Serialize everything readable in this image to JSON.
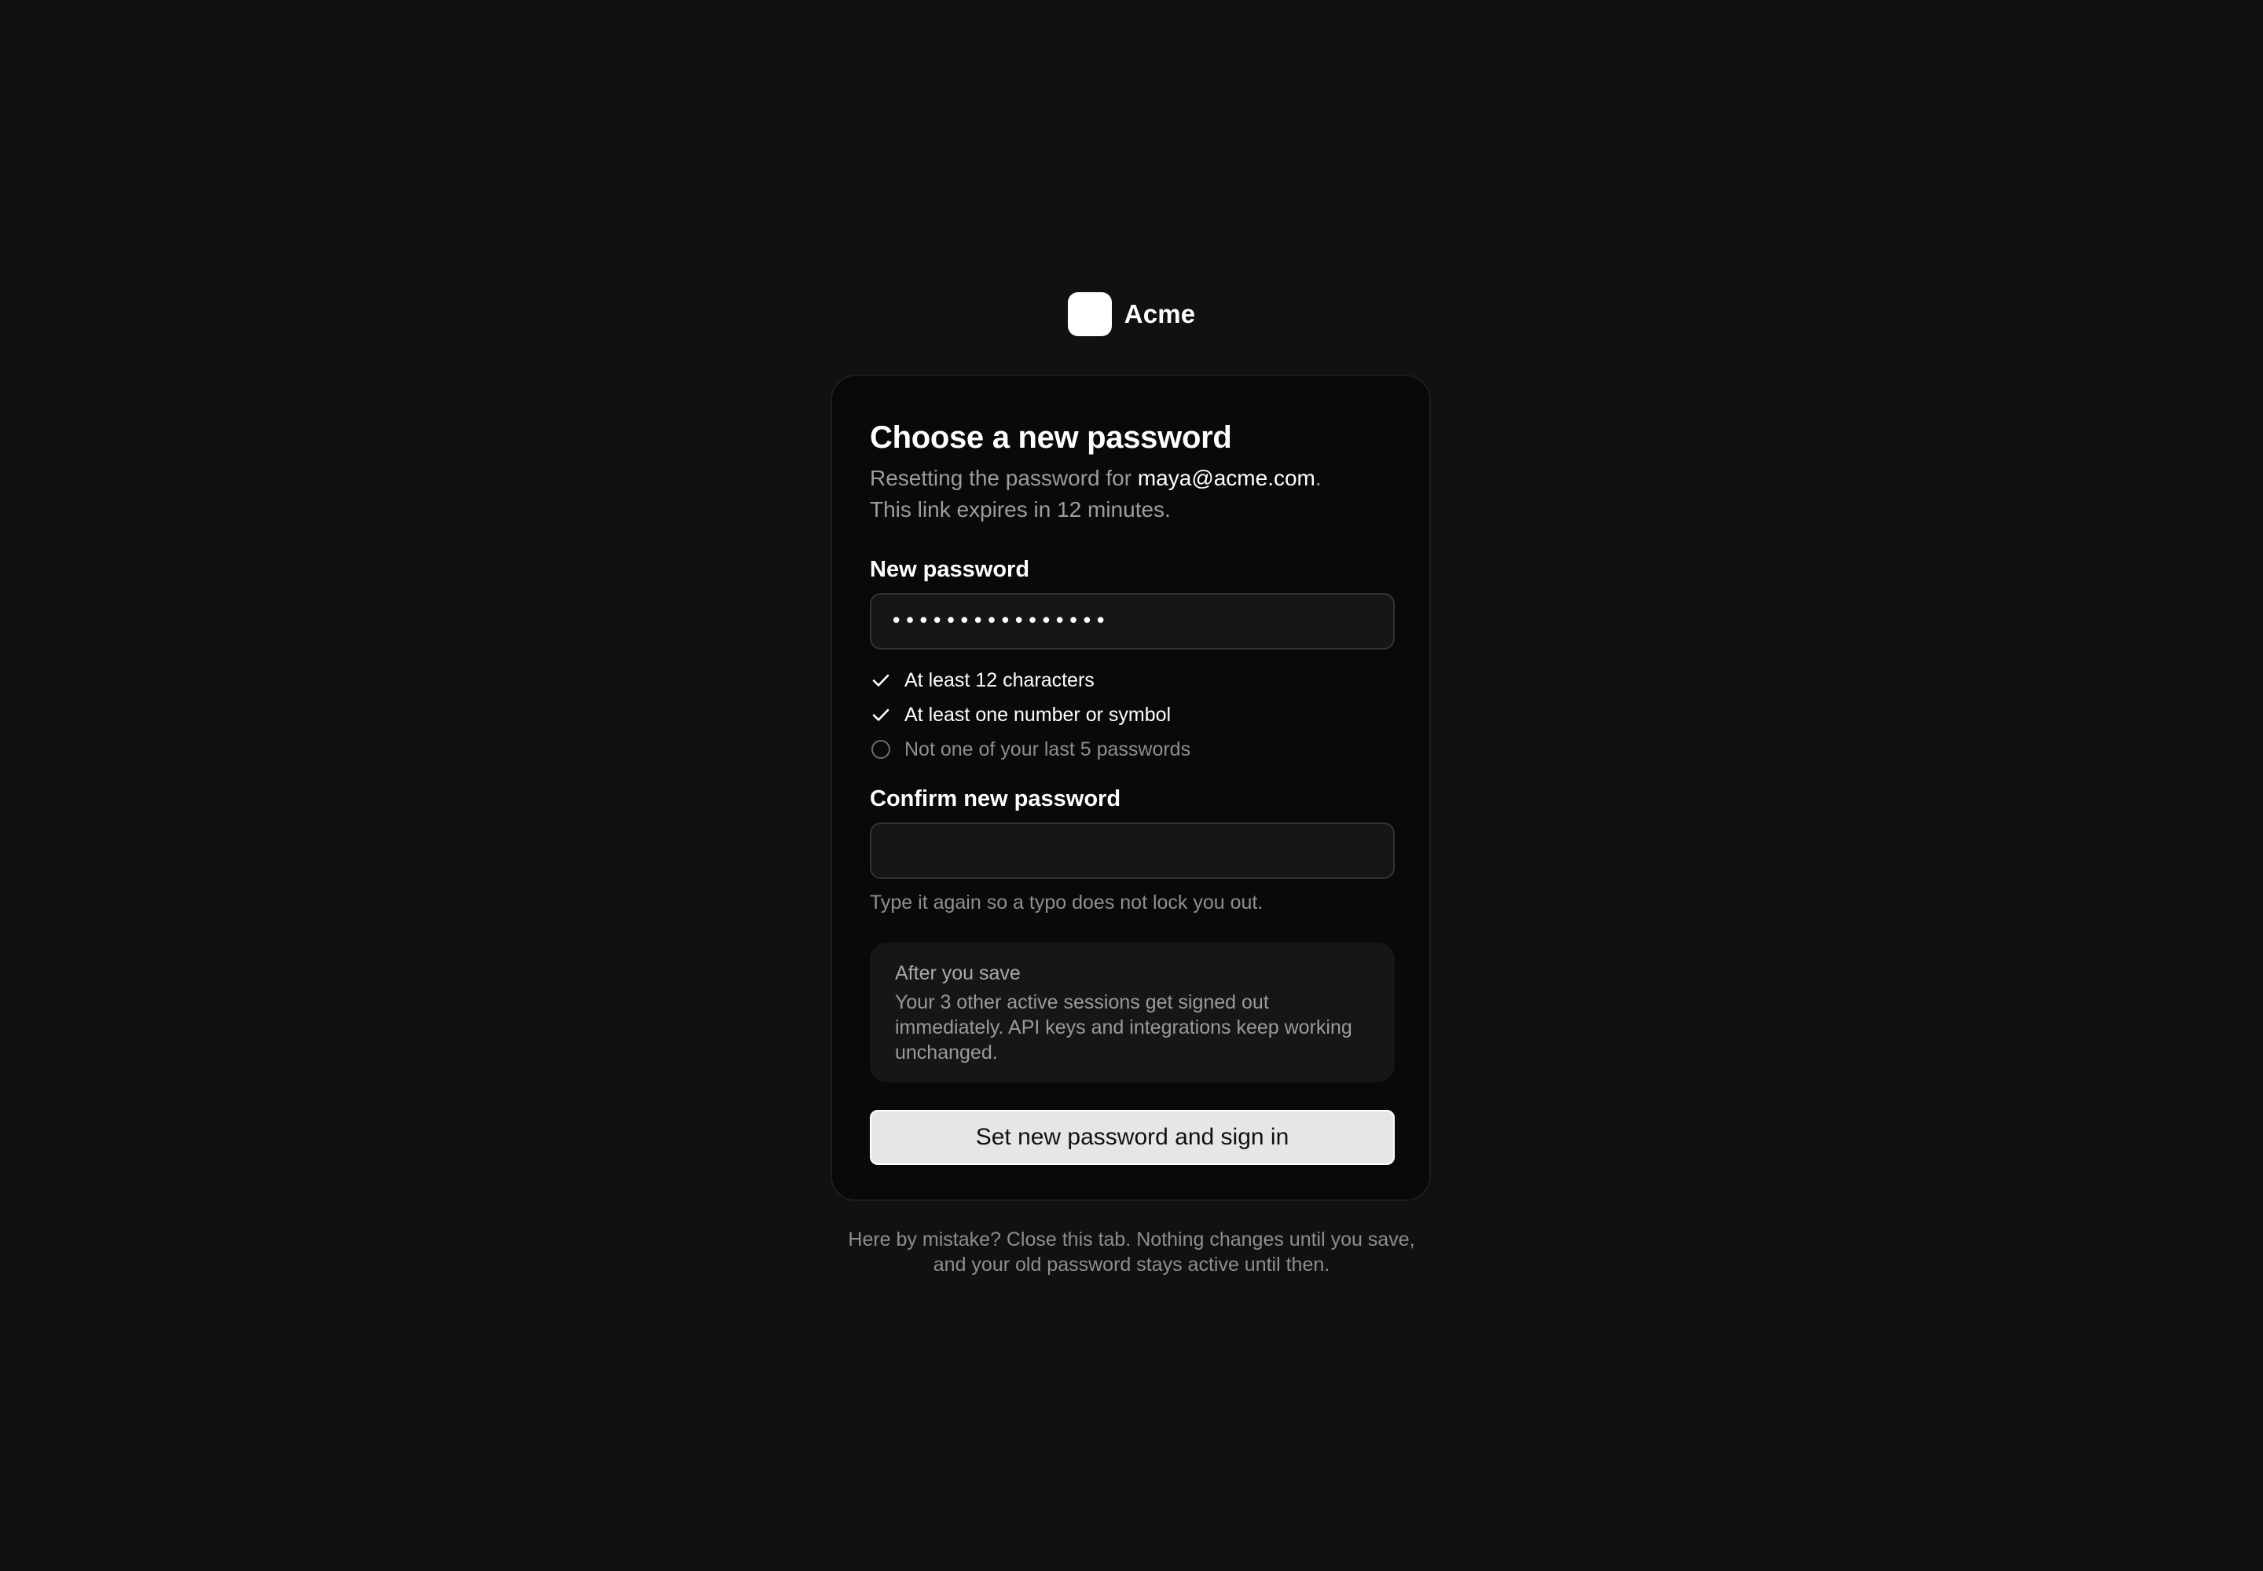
{
  "brand": {
    "name": "Acme"
  },
  "form": {
    "title": "Choose a new password",
    "subtitle_prefix": "Resetting the password for ",
    "email": "maya@acme.com",
    "subtitle_suffix": ".",
    "subtitle_line2": "This link expires in 12 minutes.",
    "new_password": {
      "label": "New password",
      "value": "••••••••••••••••"
    },
    "requirements": [
      {
        "text": "At least 12 characters",
        "met": true,
        "icon": "check-icon"
      },
      {
        "text": "At least one number or symbol",
        "met": true,
        "icon": "check-icon"
      },
      {
        "text": "Not one of your last 5 passwords",
        "met": false,
        "icon": "circle-icon"
      }
    ],
    "confirm_password": {
      "label": "Confirm new password",
      "value": "",
      "hint": "Type it again so a typo does not lock you out."
    },
    "note": {
      "title": "After you save",
      "body": "Your 3 other active sessions get signed out immediately. API keys and integrations keep working unchanged."
    },
    "submit_label": "Set new password and sign in"
  },
  "footer": {
    "line1": "Here by mistake? Close this tab. Nothing changes until you save,",
    "line2": "and your old password stays active until then."
  },
  "colors": {
    "background": "#111111",
    "card": "#090909",
    "button": "#e6e6e6",
    "muted_text": "#9d9d9d"
  }
}
